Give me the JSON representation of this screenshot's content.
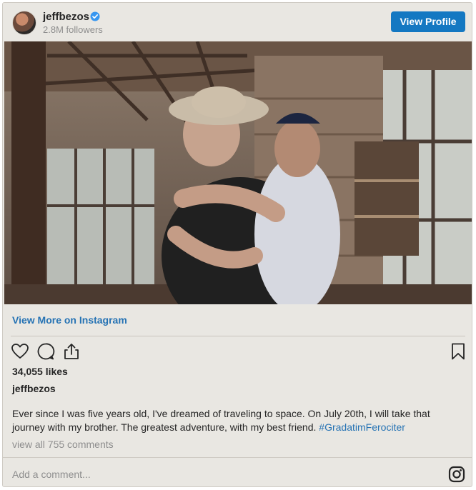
{
  "header": {
    "username": "jeffbezos",
    "followers": "2.8M followers",
    "view_profile_label": "View Profile"
  },
  "post": {
    "view_more_label": "View More on Instagram",
    "likes": "34,055 likes",
    "caption_user": "jeffbezos",
    "caption_text": "Ever since I was five years old, I've dreamed of traveling to space. On July 20th, I will take that journey with my brother. The greatest adventure, with my best friend. ",
    "caption_hashtag": "#GradatimFerociter",
    "view_comments_label": "view all 755 comments",
    "add_comment_placeholder": "Add a comment..."
  },
  "icons": {
    "verified": "verified-badge-icon",
    "like": "heart-icon",
    "comment": "comment-icon",
    "share": "share-icon",
    "save": "bookmark-icon",
    "instagram": "instagram-icon"
  },
  "colors": {
    "button_blue": "#1478c2",
    "link_blue": "#2673b4",
    "card_bg": "#e9e7e2"
  }
}
